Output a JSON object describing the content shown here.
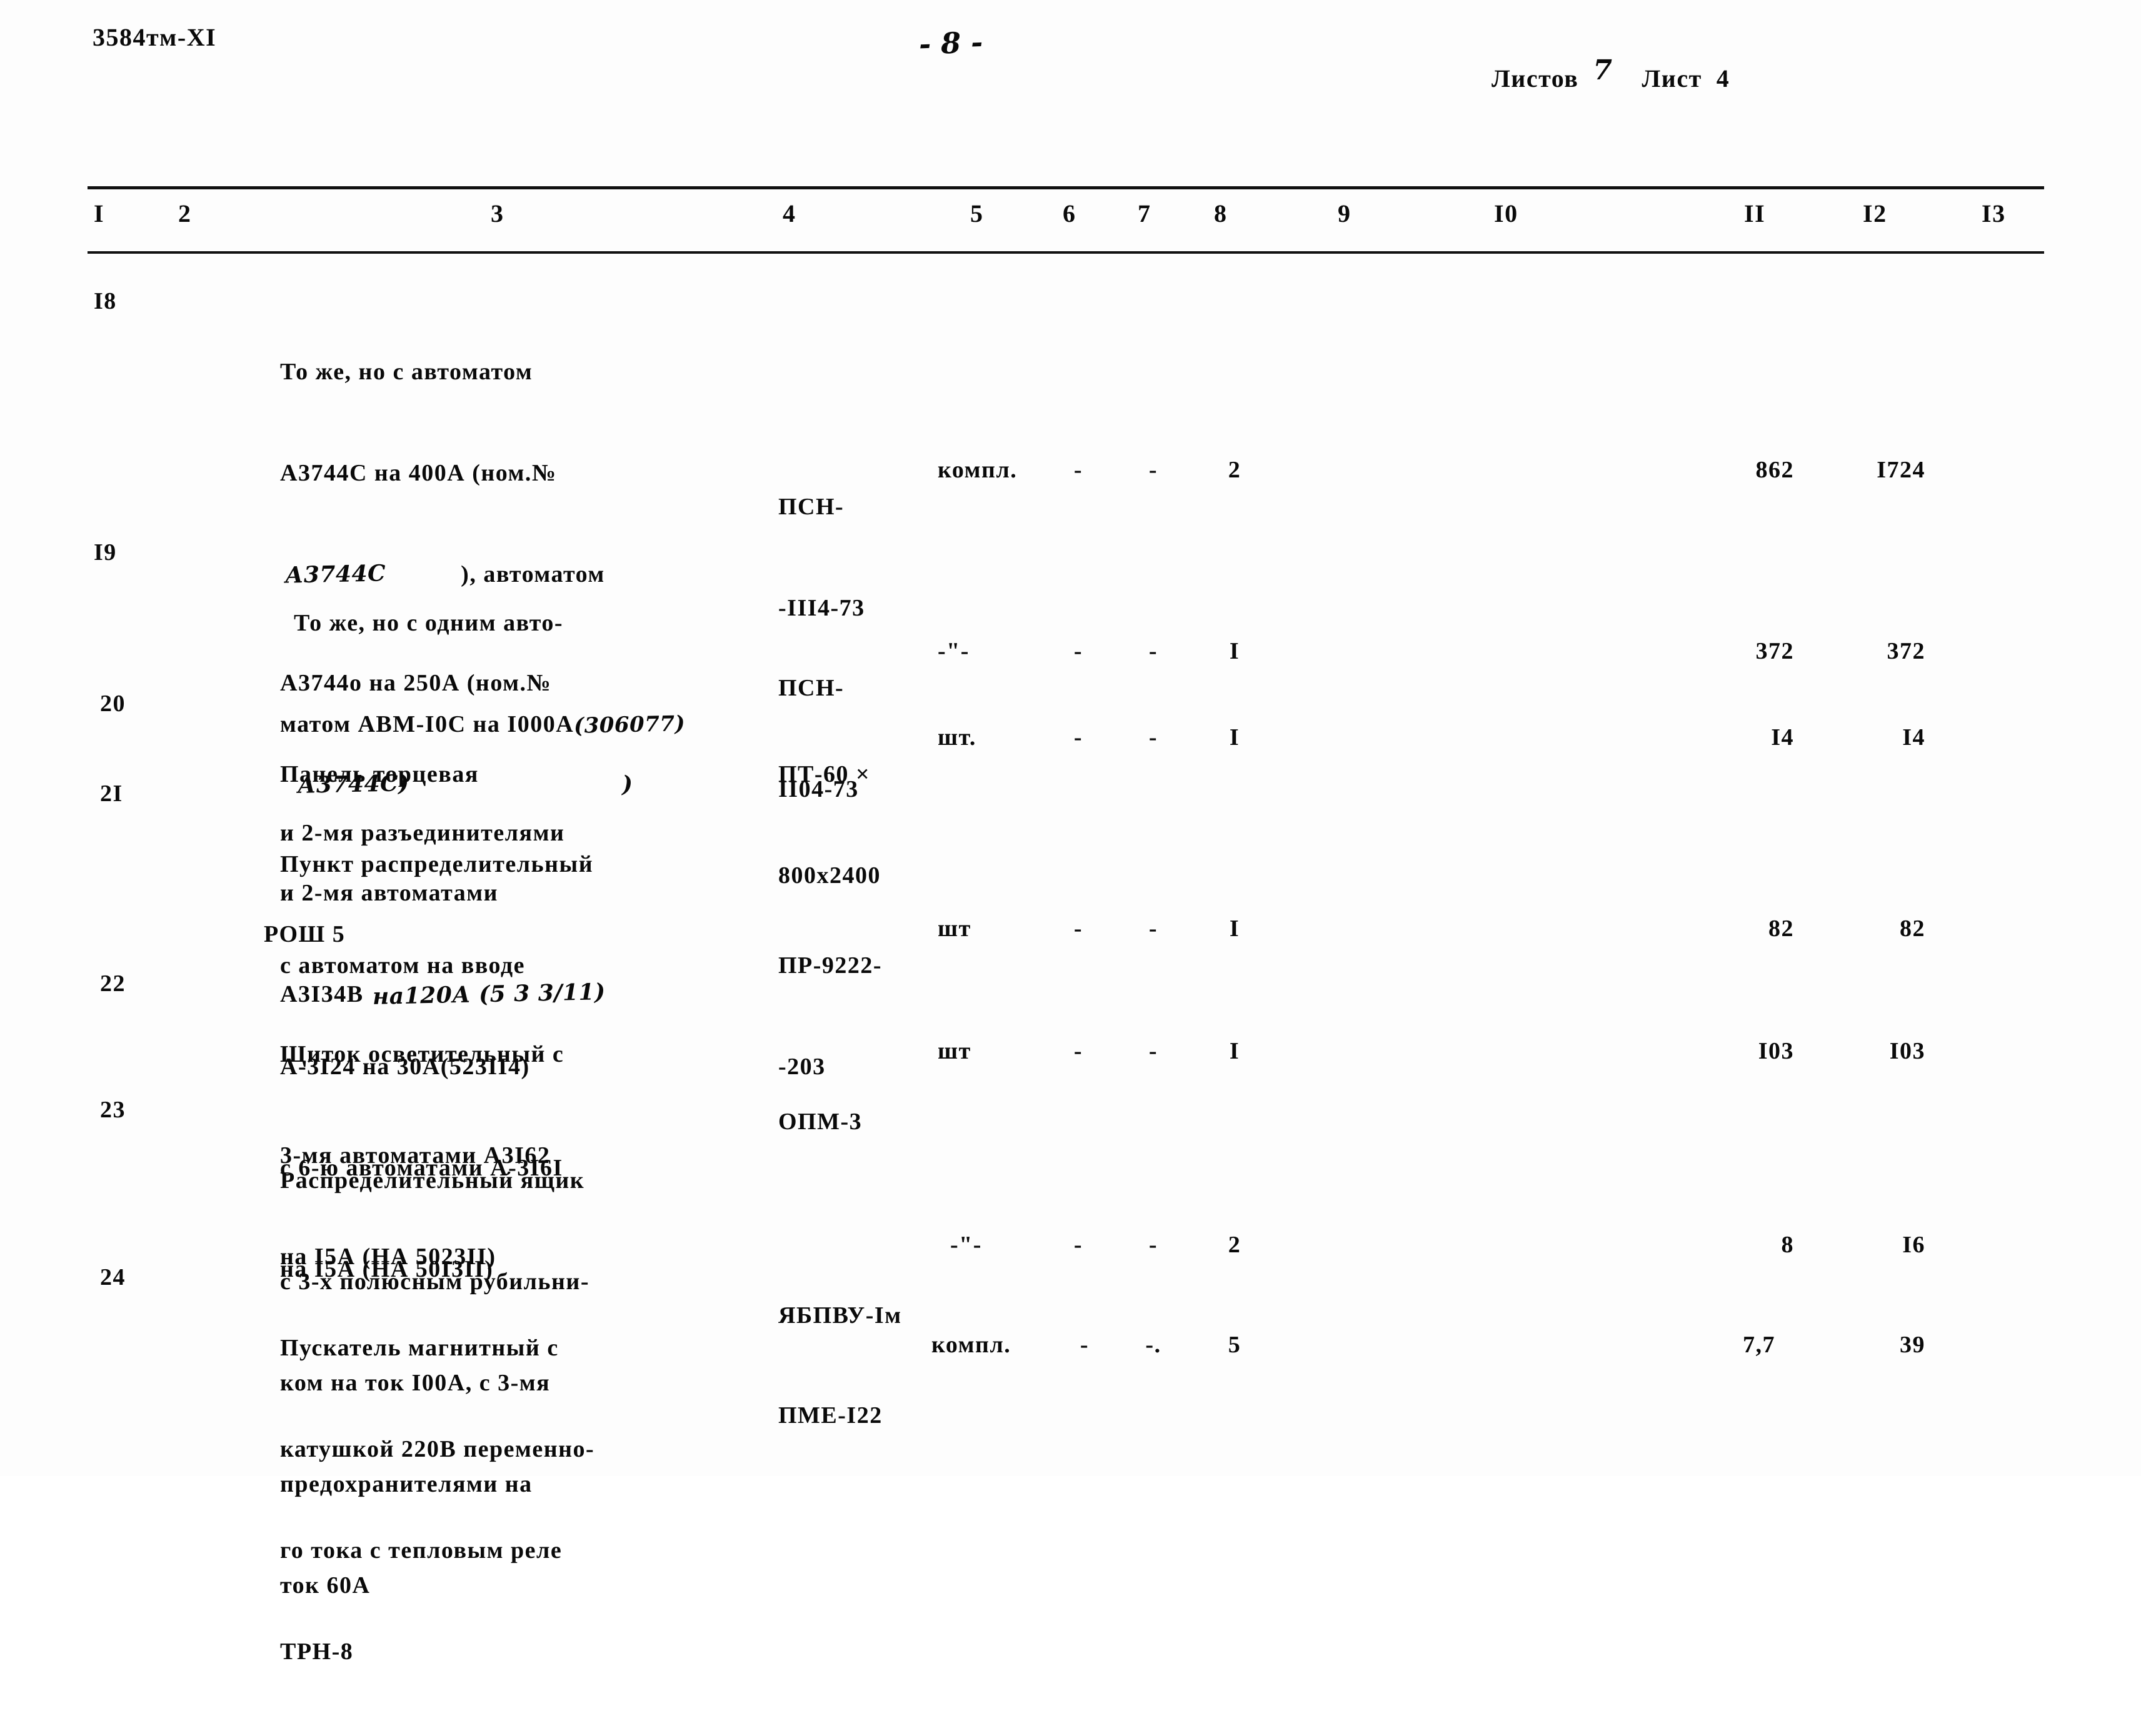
{
  "header": {
    "doc_code": "3584тм-XI",
    "page_number": "- 8 -",
    "sheets_label": "Листов",
    "sheets_count": "7",
    "sheet_label": "Лист",
    "sheet_number": "4"
  },
  "table": {
    "column_headers": [
      "I",
      "2",
      "3",
      "4",
      "5",
      "6",
      "7",
      "8",
      "9",
      "I0",
      "II",
      "I2",
      "I3"
    ],
    "rows": [
      {
        "num": "I8",
        "name_lines": [
          "То же, но с автоматом",
          "А3744С на 400А (ном.№"
        ],
        "annot_1": "А3744С",
        "name_lines_2": [
          "), автоматом",
          "А3744о на 250А (ном.№"
        ],
        "annot_2": "А3744С)",
        "annot_2b": ")",
        "name_lines_3": [
          "и 2-мя автоматами",
          "А3I34В"
        ],
        "annot_3": "на120А (5 3 3/11)",
        "type_lines": [
          "ПСН-",
          "-III4-73"
        ],
        "unit": "компл.",
        "d6": "-",
        "d7": "-",
        "d8": "2",
        "c11": "862",
        "c12": "I724"
      },
      {
        "num": "I9",
        "name_lines": [
          "То же, но с одним авто-",
          "матом АВМ-I0С на I000А"
        ],
        "annot_1": "(306077)",
        "name_lines_2": [
          "и 2-мя разъединителями",
          "РОШ 5"
        ],
        "type_lines": [
          "ПСН-",
          "II04-73"
        ],
        "unit": "-\"-",
        "d6": "-",
        "d7": "-",
        "d8": "I",
        "c11": "372",
        "c12": "372"
      },
      {
        "num": "20",
        "name_lines": [
          "Панель торцевая"
        ],
        "type_lines": [
          "ПТ-60 ×",
          "800х2400"
        ],
        "unit": "шт.",
        "d6": "-",
        "d7": "-",
        "d8": "I",
        "c11": "I4",
        "c12": "I4"
      },
      {
        "num": "2I",
        "name_lines": [
          "Пункт распределительный",
          "с автоматом на вводе",
          "А-3I24 на 30А(523II4)",
          "с 6-ю автоматами А-3I6I",
          "на I5А (НА 50I3II)"
        ],
        "type_lines": [
          "ПР-9222-",
          "-203"
        ],
        "unit": "шт",
        "d6": "-",
        "d7": "-",
        "d8": "I",
        "c11": "82",
        "c12": "82"
      },
      {
        "num": "22",
        "name_lines": [
          "Щиток осветительный с",
          "3-мя автоматами А3I62",
          "на I5А (НА 5023II)"
        ],
        "type_lines": [
          "ОПМ-3"
        ],
        "unit": "шт",
        "d6": "-",
        "d7": "-",
        "d8": "I",
        "c11": "I03",
        "c12": "I03"
      },
      {
        "num": "23",
        "name_lines": [
          "Распределительный ящик",
          "с 3-х полюсным рубильни-",
          "ком на ток I00А, с 3-мя",
          "предохранителями на",
          "ток 60А"
        ],
        "type_lines": [
          "ЯБПВУ-Iм"
        ],
        "unit": "-\"-",
        "d6": "-",
        "d7": "-",
        "d8": "2",
        "c11": "8",
        "c12": "I6"
      },
      {
        "num": "24",
        "name_lines": [
          "Пускатель магнитный с",
          "катушкой 220В переменно-",
          "го тока с тепловым реле",
          "ТРН-8"
        ],
        "type_lines": [
          "ПМЕ-I22"
        ],
        "unit": "компл.",
        "d6": "-",
        "d7": "-.",
        "d8": "5",
        "c11": "7,7",
        "c12": "39"
      }
    ]
  }
}
